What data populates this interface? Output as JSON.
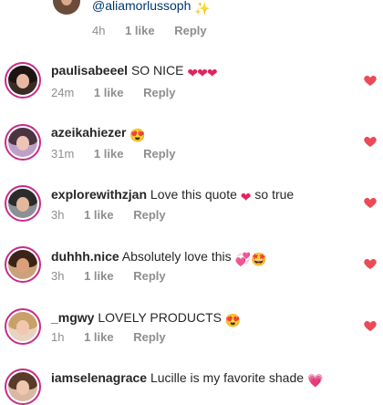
{
  "reply_top": {
    "mention": "@aliamorlussoph",
    "time": "4h",
    "likes": "1 like",
    "reply": "Reply",
    "sparkle": "✨"
  },
  "comments": [
    {
      "username": "paulisabeeel",
      "text": "SO NICE",
      "emoji": "❤❤❤",
      "time": "24m",
      "likes": "1 like",
      "reply": "Reply"
    },
    {
      "username": "azeikahiezer",
      "text": "",
      "emoji": "😍",
      "time": "31m",
      "likes": "1 like",
      "reply": "Reply"
    },
    {
      "username": "explorewithzjan",
      "text": "Love this quote",
      "emoji": "❤",
      "text2": "so true",
      "time": "3h",
      "likes": "1 like",
      "reply": "Reply"
    },
    {
      "username": "duhhh.nice",
      "text": "Absolutely love this",
      "emoji": "💞🤩",
      "time": "3h",
      "likes": "1 like",
      "reply": "Reply"
    },
    {
      "username": "_mgwy",
      "text": "LOVELY PRODUCTS",
      "emoji": "😍",
      "time": "1h",
      "likes": "1 like",
      "reply": "Reply"
    },
    {
      "username": "iamselenagrace",
      "text": "Lucille is my favorite shade",
      "emoji": "💗"
    }
  ],
  "colors": {
    "heart": "#ed4956",
    "ring": "#c82b8a",
    "meta": "#8e8e8e",
    "mention": "#00376b"
  },
  "icons": [
    "heart-icon",
    "sparkles-icon"
  ]
}
